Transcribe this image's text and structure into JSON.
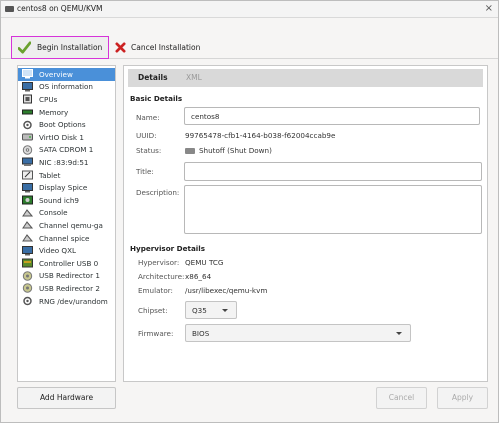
{
  "window": {
    "title": "centos8 on QEMU/KVM",
    "close": "×"
  },
  "toolbar": {
    "begin_label": "Begin Installation",
    "cancel_label": "Cancel Installation"
  },
  "sidebar": {
    "items": [
      {
        "label": "Overview",
        "icon": "overview-icon",
        "selected": true
      },
      {
        "label": "OS information",
        "icon": "os-info-icon"
      },
      {
        "label": "CPUs",
        "icon": "cpu-icon"
      },
      {
        "label": "Memory",
        "icon": "memory-icon"
      },
      {
        "label": "Boot Options",
        "icon": "boot-options-icon"
      },
      {
        "label": "VirtIO Disk 1",
        "icon": "disk-icon"
      },
      {
        "label": "SATA CDROM 1",
        "icon": "cdrom-icon"
      },
      {
        "label": "NIC :83:9d:51",
        "icon": "nic-icon"
      },
      {
        "label": "Tablet",
        "icon": "tablet-icon"
      },
      {
        "label": "Display Spice",
        "icon": "display-icon"
      },
      {
        "label": "Sound ich9",
        "icon": "sound-icon"
      },
      {
        "label": "Console",
        "icon": "console-icon"
      },
      {
        "label": "Channel qemu-ga",
        "icon": "channel-icon"
      },
      {
        "label": "Channel spice",
        "icon": "channel-icon"
      },
      {
        "label": "Video QXL",
        "icon": "video-icon"
      },
      {
        "label": "Controller USB 0",
        "icon": "controller-icon"
      },
      {
        "label": "USB Redirector 1",
        "icon": "usb-redirector-icon"
      },
      {
        "label": "USB Redirector 2",
        "icon": "usb-redirector-icon"
      },
      {
        "label": "RNG /dev/urandom",
        "icon": "rng-icon"
      }
    ],
    "add_hardware": "Add Hardware"
  },
  "tabs": {
    "details": "Details",
    "xml": "XML"
  },
  "basic": {
    "heading": "Basic Details",
    "name_label": "Name:",
    "name_value": "centos8",
    "uuid_label": "UUID:",
    "uuid_value": "99765478-cfb1-4164-b038-f62004ccab9e",
    "status_label": "Status:",
    "status_value": "Shutoff (Shut Down)",
    "title_label": "Title:",
    "title_value": "",
    "description_label": "Description:",
    "description_value": ""
  },
  "hypervisor": {
    "heading": "Hypervisor Details",
    "hypervisor_label": "Hypervisor:",
    "hypervisor_value": "QEMU TCG",
    "architecture_label": "Architecture:",
    "architecture_value": "x86_64",
    "emulator_label": "Emulator:",
    "emulator_value": "/usr/libexec/qemu-kvm",
    "chipset_label": "Chipset:",
    "chipset_value": "Q35",
    "firmware_label": "Firmware:",
    "firmware_value": "BIOS"
  },
  "buttons": {
    "cancel": "Cancel",
    "apply": "Apply"
  },
  "colors": {
    "selection": "#4a90d9",
    "highlight_border": "#d633d9"
  }
}
